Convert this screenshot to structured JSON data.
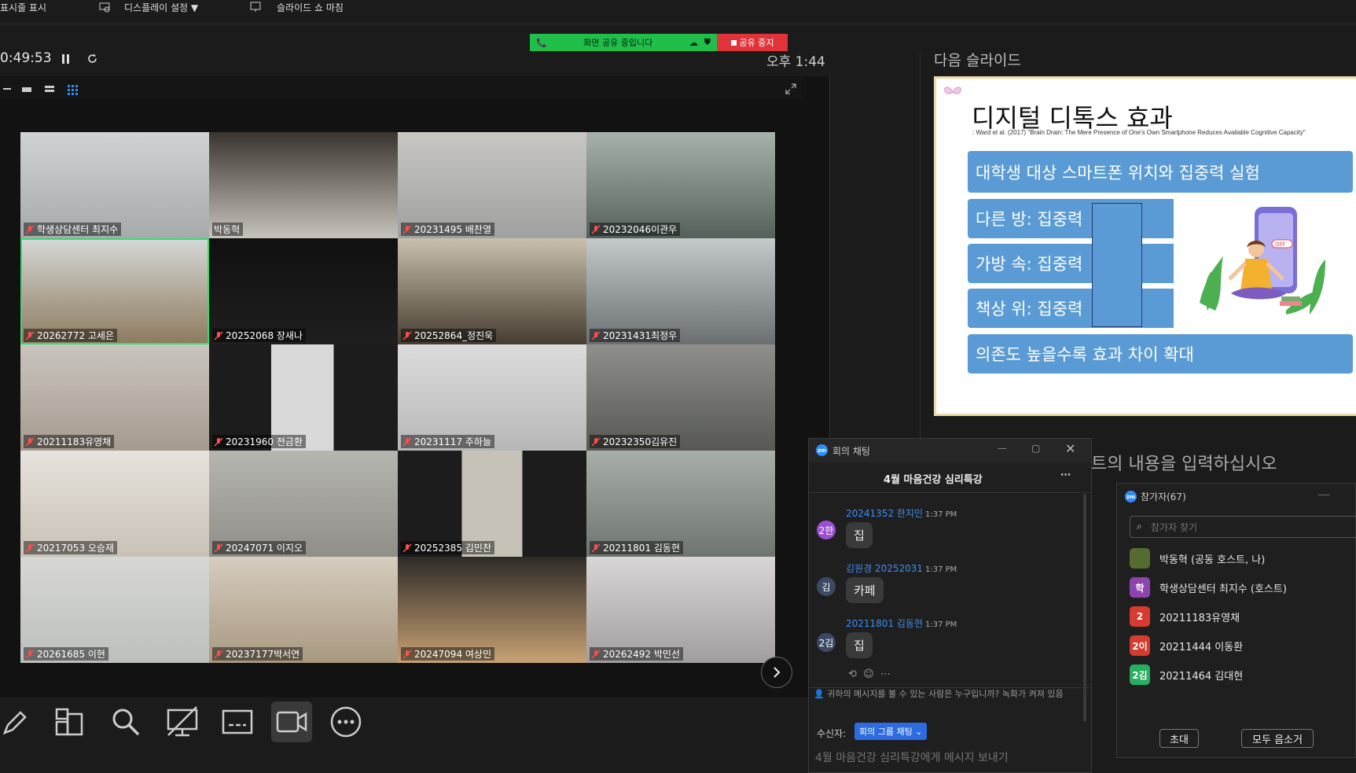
{
  "toolbar": {
    "show_toolbar": "표시줄 표시",
    "display_settings": "디스플레이 설정 ▼",
    "end_slideshow": "슬라이드 쇼 마침"
  },
  "share": {
    "status": "화면 공유 중입니다",
    "stop": "공유 중지"
  },
  "presenter": {
    "elapsed": "0:49:53",
    "clock": "오후 1:44",
    "next_slide_label": "다음 슬라이드",
    "notes_placeholder": "트의 내용을 입력하십시오"
  },
  "participants_grid": [
    {
      "name": "학생상담센터 최지수",
      "muted": true
    },
    {
      "name": "박동혁",
      "muted": false
    },
    {
      "name": "20231495 배찬열",
      "muted": true
    },
    {
      "name": "20232046이관우",
      "muted": true
    },
    {
      "name": "20262772 고세은",
      "muted": true,
      "speaking": true
    },
    {
      "name": "20252068 장새나",
      "muted": true
    },
    {
      "name": "20252864_정진욱",
      "muted": true
    },
    {
      "name": "20231431최정우",
      "muted": true
    },
    {
      "name": "20211183유영채",
      "muted": true
    },
    {
      "name": "20231960 전금환",
      "muted": true
    },
    {
      "name": "20231117 주하늘",
      "muted": true
    },
    {
      "name": "20232350김유진",
      "muted": true
    },
    {
      "name": "20217053 오승재",
      "muted": true
    },
    {
      "name": "20247071 이지오",
      "muted": true
    },
    {
      "name": "20252385 김민찬",
      "muted": true
    },
    {
      "name": "20211801 김동현",
      "muted": true
    },
    {
      "name": "20261685 이현",
      "muted": true
    },
    {
      "name": "20237177박서연",
      "muted": true
    },
    {
      "name": "20247094 여상민",
      "muted": true
    },
    {
      "name": "20262492 박민선",
      "muted": true
    }
  ],
  "next_slide": {
    "title": "디지털 디톡스 효과",
    "reference": ": Ward et al. (2017) \"Brain Drain: The Mere Presence of One's Own Smartphone Reduces Available Cognitive Capacity\"",
    "boxes": [
      "대학생 대상 스마트폰 위치와 집중력 실험",
      "다른 방: 집중력",
      "가방 속: 집중력",
      "책상 위: 집중력",
      "의존도 높을수록 효과 차이 확대"
    ],
    "phone_off": "OFF"
  },
  "chat": {
    "window_title": "회의 채팅",
    "channel": "4월 마음건강 심리특강",
    "messages": [
      {
        "avatar": "2한",
        "avatar_color": "#9b4fd6",
        "sender": "20241352 한지민",
        "time": "1:37 PM",
        "text": "집"
      },
      {
        "avatar": "김",
        "avatar_color": "#3b4a63",
        "sender": "김원경 20252031",
        "time": "1:37 PM",
        "text": "카페"
      },
      {
        "avatar": "2김",
        "avatar_color": "#3b4a63",
        "sender": "20211801 김동현",
        "time": "1:37 PM",
        "text": "집"
      }
    ],
    "visibility_notice": "귀하의 메시지를 볼 수 있는 사람은 누구입니까? 녹화가 켜져 있음",
    "recipient_label": "수신자:",
    "recipient_value": "회의 그룹 채팅 ⌄",
    "input_placeholder": "4월 마음건강 심리특강에게 메시지 보내기"
  },
  "people": {
    "title": "참가자(67)",
    "search_placeholder": "참가자 찾기",
    "list": [
      {
        "avatar": "",
        "color": "#556b2f",
        "name": "박동혁 (공동 호스트, 나)"
      },
      {
        "avatar": "학",
        "color": "#8e44ad",
        "name": "학생상담센터 최지수 (호스트)"
      },
      {
        "avatar": "2",
        "color": "#d63b2f",
        "name": "20211183유영채"
      },
      {
        "avatar": "2이",
        "color": "#d63b2f",
        "name": "20211444 이동환"
      },
      {
        "avatar": "2김",
        "color": "#27ae60",
        "name": "20211464 김대현"
      }
    ],
    "invite": "초대",
    "mute_all": "모두 음소거"
  }
}
